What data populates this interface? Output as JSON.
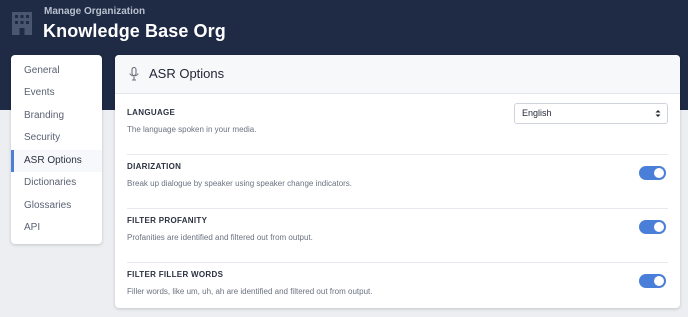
{
  "header": {
    "subtitle": "Manage Organization",
    "title": "Knowledge Base Org",
    "background_color": "#1f2a44"
  },
  "sidebar": {
    "items": [
      {
        "label": "General",
        "active": false
      },
      {
        "label": "Events",
        "active": false
      },
      {
        "label": "Branding",
        "active": false
      },
      {
        "label": "Security",
        "active": false
      },
      {
        "label": "ASR Options",
        "active": true
      },
      {
        "label": "Dictionaries",
        "active": false
      },
      {
        "label": "Glossaries",
        "active": false
      },
      {
        "label": "API",
        "active": false
      }
    ],
    "active_color": "#4e7fd6"
  },
  "panel": {
    "title": "ASR Options",
    "icon": "microphone-icon",
    "settings": [
      {
        "label": "LANGUAGE",
        "description": "The language spoken in your media.",
        "control": "select",
        "value": "English"
      },
      {
        "label": "DIARIZATION",
        "description": "Break up dialogue by speaker using speaker change indicators.",
        "control": "toggle",
        "enabled": true
      },
      {
        "label": "FILTER PROFANITY",
        "description": "Profanities are identified and filtered out from output.",
        "control": "toggle",
        "enabled": true
      },
      {
        "label": "FILTER FILLER WORDS",
        "description": "Filler words, like um, uh, ah are identified and filtered out from output.",
        "control": "toggle",
        "enabled": true
      }
    ],
    "toggle_color": "#4a7fd9"
  }
}
